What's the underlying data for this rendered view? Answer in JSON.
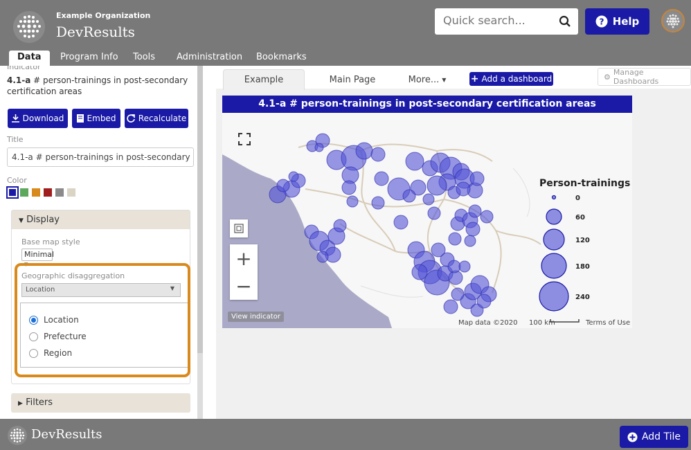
{
  "header": {
    "org_name": "Example Organization",
    "app_name": "DevResults",
    "search_placeholder": "Quick search...",
    "help_label": "Help"
  },
  "nav_tabs": [
    "Data",
    "Program Info",
    "Tools",
    "Administration",
    "Bookmarks"
  ],
  "sidebar": {
    "indicator_label": "Indicator",
    "indicator_code": "4.1-a",
    "indicator_name": " # person-trainings in post-secondary certification areas",
    "download_label": "Download",
    "embed_label": "Embed",
    "recalculate_label": "Recalculate",
    "title_label": "Title",
    "title_value": "4.1-a # person-trainings in post-secondary certification areas",
    "color_label": "Color",
    "colors": [
      "#1a1aa6",
      "#5ea85e",
      "#d98a1c",
      "#a01d1d",
      "#8a8a8a",
      "#d9d4c4"
    ],
    "display_label": "Display",
    "base_map_label": "Base map style",
    "base_map_value": "Minimal",
    "geo_label": "Geographic disaggregation",
    "geo_value": "Location",
    "geo_options": [
      "Location",
      "Prefecture",
      "Region"
    ],
    "filters_label": "Filters"
  },
  "content_tabs": [
    "Example",
    "Main Page",
    "More..."
  ],
  "add_dashboard_label": "Add a dashboard",
  "manage_dashboards_label": "Manage Dashboards",
  "tile": {
    "title": "4.1-a # person-trainings in post-secondary certification areas",
    "legend_title": "Person-trainings",
    "legend_values": [
      "0",
      "60",
      "120",
      "180",
      "240"
    ],
    "view_indicator": "View indicator",
    "map_data": "Map data ©2020",
    "scale": "100 km",
    "terms": "Terms of Use"
  },
  "footer": {
    "app_name": "DevResults",
    "add_tile_label": "Add Tile"
  },
  "colors": {
    "accent": "#1a1aa6",
    "header_bg": "#797979",
    "highlight": "#d98a1c",
    "bubble": "#5454d6"
  }
}
